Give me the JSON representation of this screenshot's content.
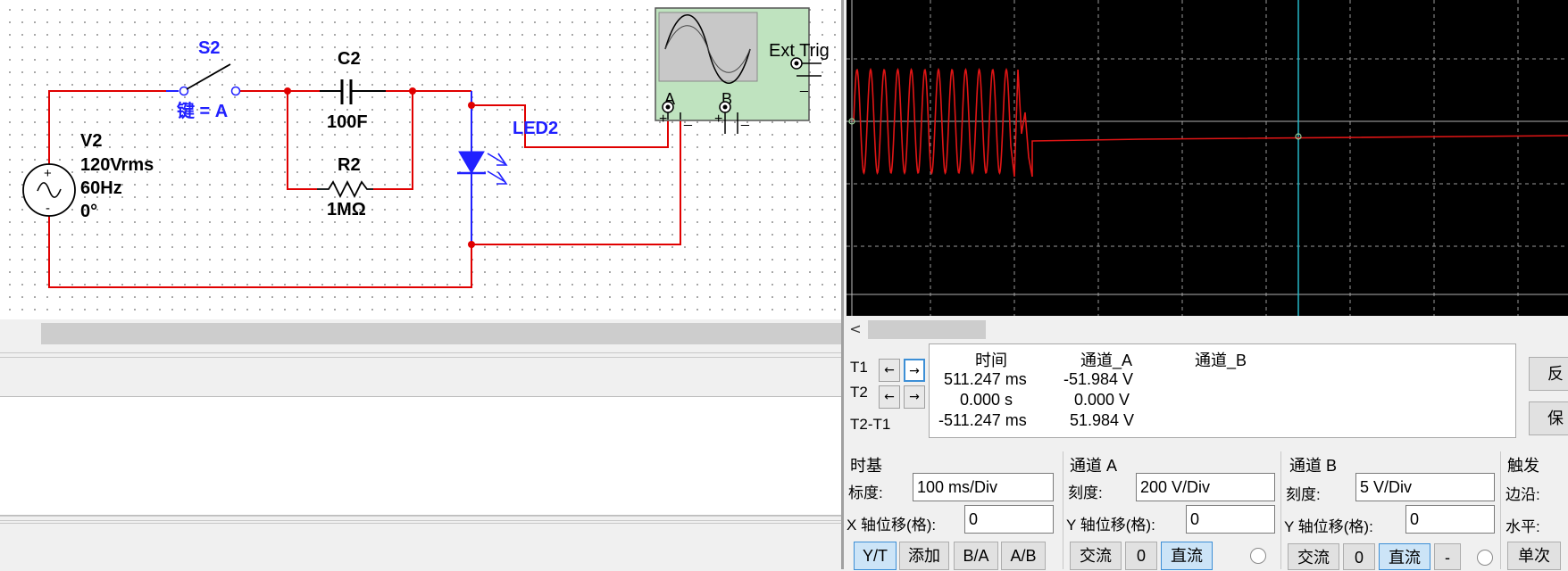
{
  "circuit": {
    "switch": {
      "name": "S2",
      "key": "键 = A"
    },
    "capacitor": {
      "name": "C2",
      "value": "100F"
    },
    "resistor": {
      "name": "R2",
      "value": "1MΩ"
    },
    "source": {
      "name": "V2",
      "voltage": "120Vrms",
      "frequency": "60Hz",
      "phase": "0°",
      "plus": "+",
      "minus": "-"
    },
    "led": {
      "name": "LED2"
    },
    "scope_symbol": {
      "ext_trig": "Ext Trig",
      "channel_a": "A",
      "channel_b": "B",
      "plus_a": "+",
      "minus_a": "_",
      "plus_b": "+",
      "minus_b": "_",
      "ext_minus": "_"
    }
  },
  "scope": {
    "scroll_left": "<",
    "cursors": {
      "t1": "T1",
      "t2": "T2",
      "t2_t1": "T2-T1",
      "left_arrow": "←",
      "right_arrow": "→"
    },
    "readout": {
      "headers": {
        "time": "时间",
        "channel_a": "通道_A",
        "channel_b": "通道_B"
      },
      "rows": [
        {
          "time": "511.247 ms",
          "a": "-51.984 V"
        },
        {
          "time": "0.000 s",
          "a": "0.000 V"
        },
        {
          "time": "-511.247 ms",
          "a": "51.984 V"
        }
      ]
    },
    "side_buttons": {
      "reverse": "反",
      "save": "保"
    },
    "timebase": {
      "title": "时基",
      "scale_label": "标度:",
      "scale_value": "100 ms/Div",
      "xpos_label": "X 轴位移(格):",
      "xpos_value": "0",
      "buttons": [
        "Y/T",
        "添加",
        "B/A",
        "A/B"
      ]
    },
    "channel_a": {
      "title": "通道 A",
      "scale_label": "刻度:",
      "scale_value": "200  V/Div",
      "ypos_label": "Y 轴位移(格):",
      "ypos_value": "0",
      "buttons": [
        "交流",
        "0",
        "直流"
      ]
    },
    "channel_b": {
      "title": "通道 B",
      "scale_label": "刻度:",
      "scale_value": "5  V/Div",
      "ypos_label": "Y 轴位移(格):",
      "ypos_value": "0",
      "buttons": [
        "交流",
        "0",
        "直流",
        "-"
      ]
    },
    "trigger": {
      "title": "触发",
      "edge_label": "边沿:",
      "level_label": "水平:",
      "single_button": "单次"
    }
  }
}
